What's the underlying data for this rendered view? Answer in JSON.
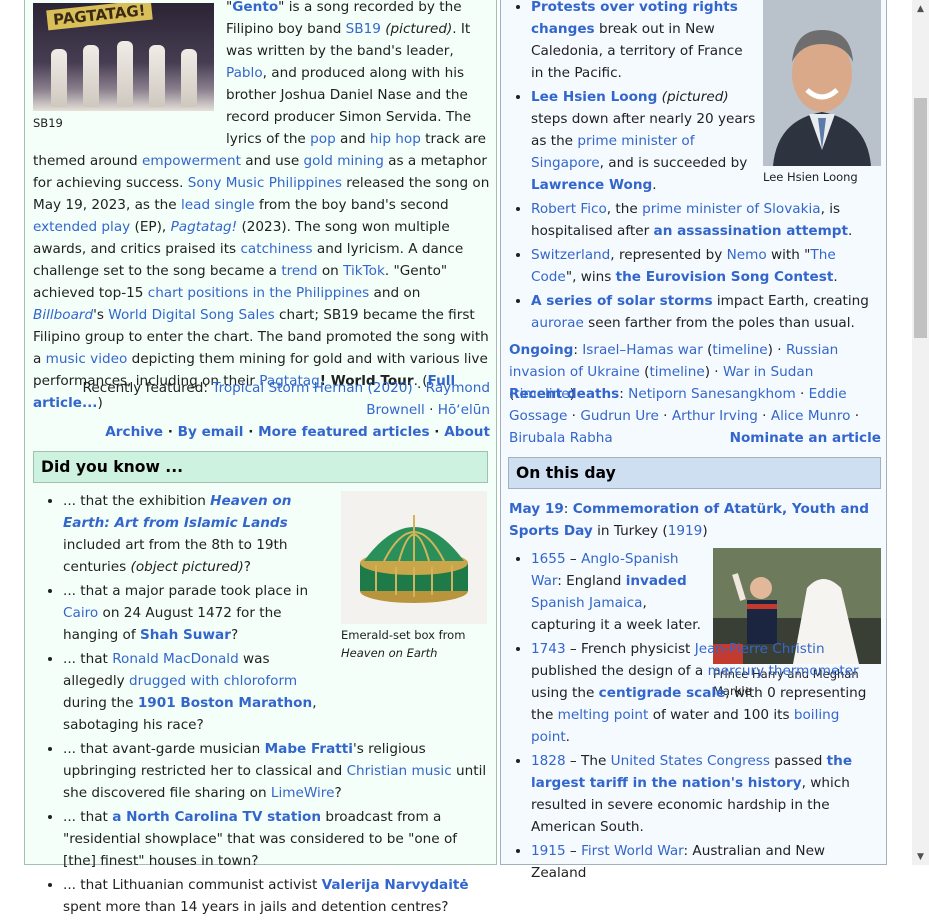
{
  "tfa": {
    "caption": "SB19",
    "image_banner": "PAGTATAG!",
    "title": "Gento",
    "p1": " is a song recorded by the Filipino boy band ",
    "band": "SB19",
    "pictured": "(pictured)",
    "p2": ". It was written by the band's leader, ",
    "leader": "Pablo",
    "p3": ", and produced along with his brother Joshua Daniel Nase and the record producer Simon Servida. The lyrics of the ",
    "pop": "pop",
    "and": " and ",
    "hiphop": "hip hop",
    "p4": " track are themed around ",
    "empowerment": "empowerment",
    "p5": " and use ",
    "goldmining": "gold mining",
    "p6": " as a metaphor for achieving success. ",
    "sony": "Sony Music Philippines",
    "p7": " released the song on May 19, 2023, as the ",
    "leadsingle": "lead single",
    "p8": " from the boy band's second ",
    "ep": "extended play",
    "p9": " (EP), ",
    "album": "Pagtatag!",
    "p10": " (2023). The song won multiple awards, and critics praised its ",
    "catchiness": "catchiness",
    "p11": " and lyricism. A dance challenge set to the song became a ",
    "trend": "trend",
    "p12": " on ",
    "tiktok": "TikTok",
    "p13": ". \"Gento\" achieved top-15 ",
    "chartpos": "chart positions in the Philippines",
    "p14": " and on ",
    "billboard": "Billboard",
    "p15": "'s ",
    "wdss": "World Digital Song Sales",
    "p16": " chart; SB19 became the first Filipino group to enter the chart. The band promoted the song with a ",
    "mv": "music video",
    "p17": " depicting them mining for gold and with various live performances, including on their ",
    "tour_a": "Pagtatag",
    "tour_b": "! World Tour",
    "p18": ". (",
    "full": "Full article...",
    "p19": ")",
    "recently_label": "Recently featured: ",
    "recent1": "Tropical Storm Hernan (2020)",
    "sep": " · ",
    "recent2": "Raymond Brownell",
    "recent3": "Hōʻelūn",
    "footer": [
      "Archive",
      "By email",
      "More featured articles",
      "About"
    ]
  },
  "dyk": {
    "header": "Did you know ...",
    "caption_a": "Emerald-set box from ",
    "caption_b": "Heaven on Earth",
    "items": [
      {
        "pre": "... that the exhibition ",
        "link": "Heaven on Earth: Art from Islamic Lands",
        "post": " included art from the 8th to 19th centuries ",
        "note": "(object pictured)",
        "end": "?"
      },
      {
        "pre": "... that a major parade took place in ",
        "l1": "Cairo",
        "mid": " on 24 August 1472 for the hanging of ",
        "l2": "Shah Suwar",
        "end": "?"
      },
      {
        "pre": "... that ",
        "l1": "Ronald MacDonald",
        "mid": " was allegedly ",
        "l2": "drugged with chloroform",
        "mid2": " during the ",
        "l3": "1901 Boston Marathon",
        "end": ", sabotaging his race?"
      },
      {
        "pre": "... that avant-garde musician ",
        "l1": "Mabe Fratti",
        "mid": "'s religious upbringing restricted her to classical and ",
        "l2": "Christian music",
        "mid2": " until she discovered file sharing on ",
        "l3": "LimeWire",
        "end": "?"
      },
      {
        "pre": "... that ",
        "l1": "a North Carolina TV station",
        "mid": " broadcast from a \"residential showplace\" that was considered to be \"one of [the] finest\" houses in town?"
      },
      {
        "pre": "... that Lithuanian communist activist ",
        "l1": "Valerija Narvydaitė",
        "mid": " spent more than 14 years in jails and detention centres?"
      }
    ]
  },
  "itn": {
    "caption": "Lee Hsien Loong",
    "items": [
      {
        "l1": "Protests over voting rights changes",
        "mid": " break out in New Caledonia, a territory of France in the Pacific."
      },
      {
        "l1": "Lee Hsien Loong",
        "note": " (pictured)",
        "mid": " steps down after nearly 20 years as the ",
        "l2": "prime minister of Singapore",
        "mid2": ", and is succeeded by ",
        "l3": "Lawrence Wong",
        "end": "."
      },
      {
        "l1": "Robert Fico",
        "mid": ", the ",
        "l2": "prime minister of Slovakia",
        "mid2": ", is hospitalised after ",
        "l3": "an assassination attempt",
        "end": "."
      },
      {
        "l1": "Switzerland",
        "mid": ", represented by ",
        "l2": "Nemo",
        "mid2": " with \"",
        "l3": "The Code",
        "mid3": "\", wins ",
        "l4": "the Eurovision Song Contest",
        "end": "."
      },
      {
        "l1": "A series of solar storms",
        "mid": " impact Earth, creating ",
        "l2": "aurorae",
        "end": " seen farther from the poles than usual."
      }
    ],
    "ongoing_label": "Ongoing",
    "ongoing": [
      "Israel–Hamas war",
      "timeline",
      "Russian invasion of Ukraine",
      "timeline",
      "War in Sudan",
      "timeline"
    ],
    "deaths_label": "Recent deaths",
    "deaths": [
      "Netiporn Sanesangkhom",
      "Eddie Gossage",
      "Gudrun Ure",
      "Arthur Irving",
      "Alice Munro",
      "Birubala Rabha"
    ],
    "nominate": "Nominate an article"
  },
  "otd": {
    "header": "On this day",
    "date": "May 19",
    "event": "Commemoration of Atatürk, Youth and Sports Day",
    "in": " in Turkey (",
    "year": "1919",
    "close": ")",
    "caption": "Prince Harry and Meghan Markle",
    "items": [
      {
        "year": "1655",
        "dash": " – ",
        "l1": "Anglo-Spanish War",
        "mid": ": England ",
        "l2": "invaded",
        "sp": " ",
        "l3": "Spanish Jamaica",
        "end": ", capturing it a week later."
      },
      {
        "year": "1743",
        "dash": " – French physicist ",
        "l1": "Jean-Pierre Christin",
        "mid": " published the design of a ",
        "l2": "mercury thermometer",
        "mid2": " using the ",
        "l3": "centigrade scale",
        "mid3": ", with 0 representing the ",
        "l4": "melting point",
        "mid4": " of water and 100 its ",
        "l5": "boiling point",
        "end": "."
      },
      {
        "year": "1828",
        "dash": " – The ",
        "l1": "United States Congress",
        "mid": " passed ",
        "l2": "the largest tariff in the nation's history",
        "end": ", which resulted in severe economic hardship in the American South."
      },
      {
        "year": "1915",
        "dash": " – ",
        "l1": "First World War",
        "end": ": Australian and New Zealand"
      }
    ]
  }
}
